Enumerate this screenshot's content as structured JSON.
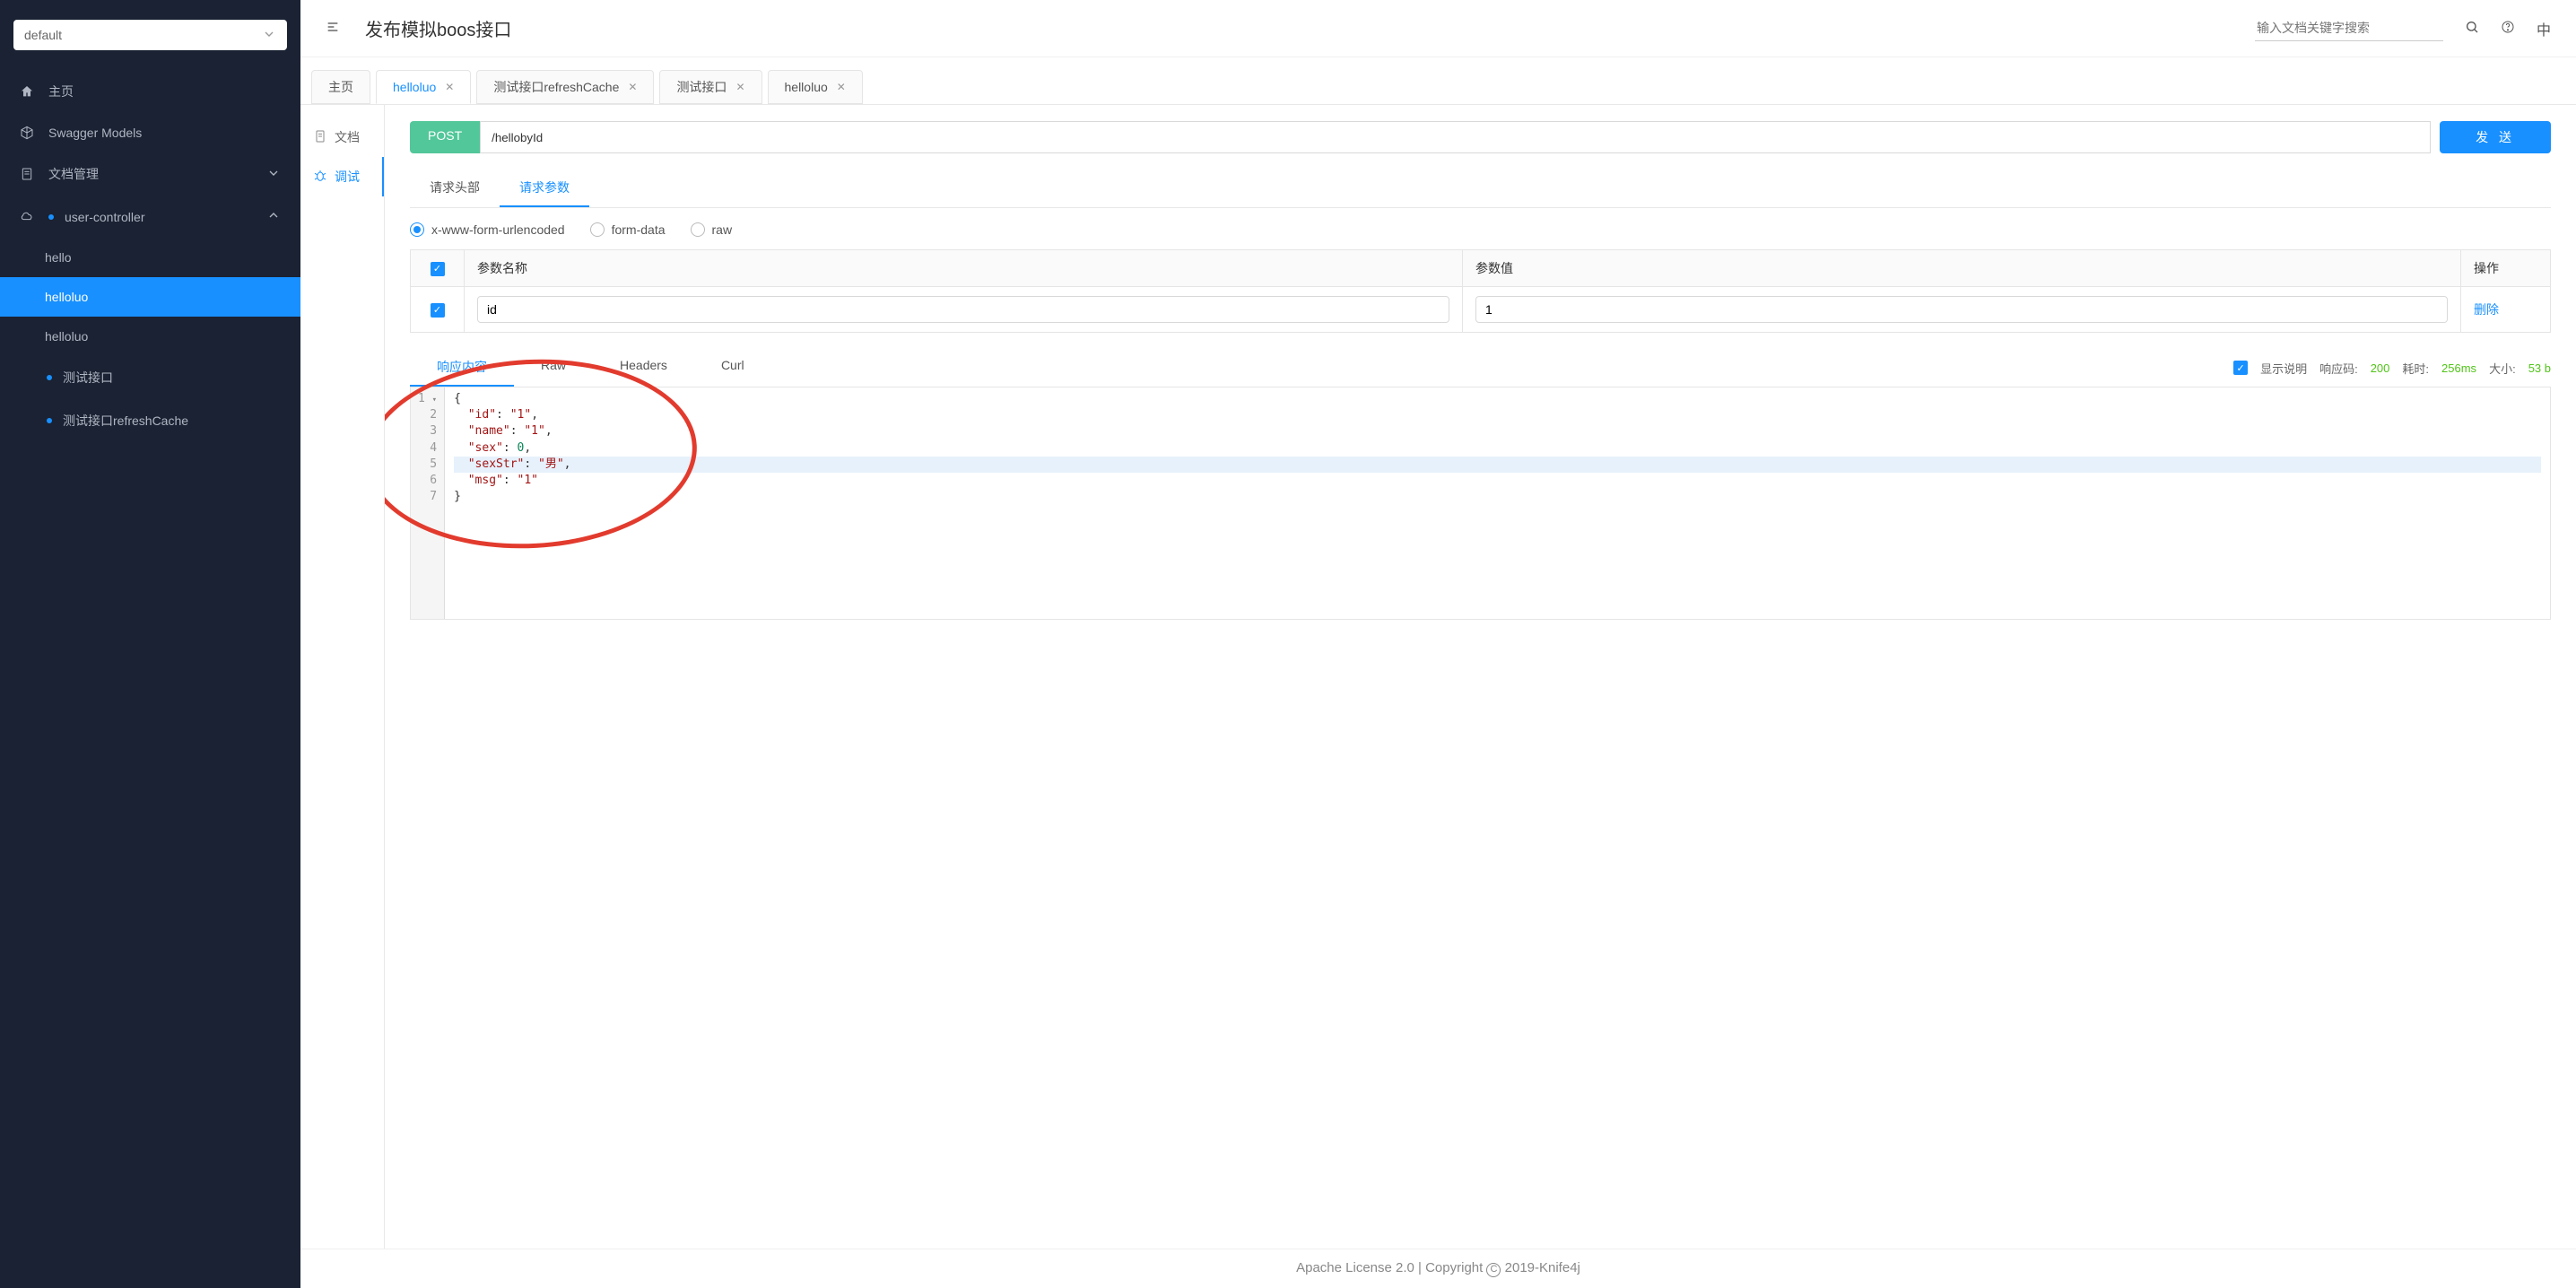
{
  "sidebar": {
    "select_value": "default",
    "items": [
      {
        "label": "主页"
      },
      {
        "label": "Swagger Models"
      },
      {
        "label": "文档管理"
      },
      {
        "label": "user-controller"
      }
    ],
    "sub_items": [
      {
        "label": "hello"
      },
      {
        "label": "helloluo"
      },
      {
        "label": "helloluo"
      },
      {
        "label": "测试接口"
      },
      {
        "label": "测试接口refreshCache"
      }
    ]
  },
  "header": {
    "title": "发布模拟boos接口",
    "search_placeholder": "输入文档关键字搜索",
    "lang": "中"
  },
  "tabs": [
    {
      "label": "主页",
      "closable": false
    },
    {
      "label": "helloluo",
      "closable": true,
      "active": true
    },
    {
      "label": "测试接口refreshCache",
      "closable": true
    },
    {
      "label": "测试接口",
      "closable": true
    },
    {
      "label": "helloluo",
      "closable": true
    }
  ],
  "left_tabs": {
    "doc": "文档",
    "debug": "调试"
  },
  "request": {
    "method": "POST",
    "url": "/hellobyId",
    "send": "发 送"
  },
  "sub_tabs": {
    "headers": "请求头部",
    "params": "请求参数"
  },
  "content_types": {
    "urlencoded": "x-www-form-urlencoded",
    "formdata": "form-data",
    "raw": "raw"
  },
  "param_table": {
    "col_name": "参数名称",
    "col_value": "参数值",
    "col_action": "操作",
    "row_name": "id",
    "row_value": "1",
    "delete": "删除"
  },
  "response": {
    "tabs": {
      "content": "响应内容",
      "raw": "Raw",
      "headers": "Headers",
      "curl": "Curl"
    },
    "show_desc": "显示说明",
    "code_label": "响应码:",
    "code": "200",
    "time_label": "耗时:",
    "time": "256ms",
    "size_label": "大小:",
    "size": "53 b",
    "json_lines": [
      "{",
      "  \"id\": \"1\",",
      "  \"name\": \"1\",",
      "  \"sex\": 0,",
      "  \"sexStr\": \"男\",",
      "  \"msg\": \"1\"",
      "}"
    ]
  },
  "footer": {
    "text_left": "Apache License 2.0 | Copyright ",
    "text_right": " 2019-Knife4j"
  }
}
